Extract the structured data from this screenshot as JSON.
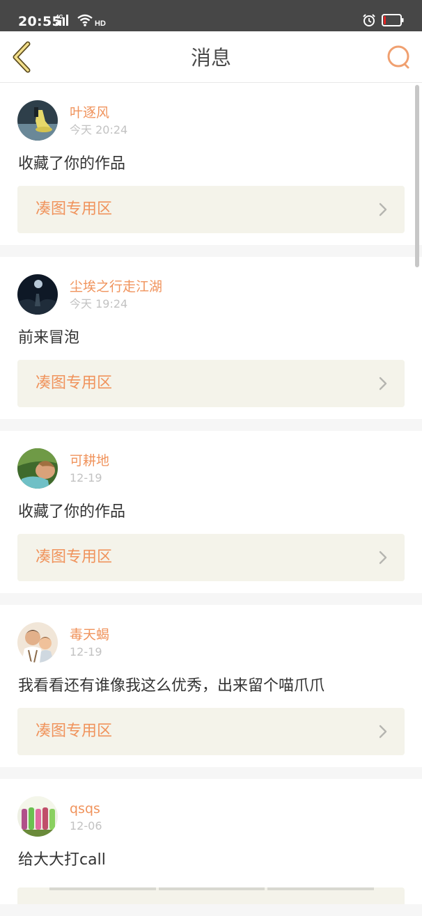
{
  "status_bar": {
    "time": "20:55",
    "network": "4G",
    "wifi_badge": "HD",
    "icons": [
      "signal-icon",
      "wifi-icon",
      "alarm-icon",
      "battery-icon"
    ],
    "battery_level": 0.15
  },
  "nav": {
    "title": "消息",
    "back_icon": "chevron-left-icon",
    "search_icon": "search-icon"
  },
  "colors": {
    "accent": "#f0935c",
    "status_bar": "#474747",
    "topic_bg": "#f4f3ea",
    "battery_low": "#e22323"
  },
  "messages": [
    {
      "user": "叶逐风",
      "time": "今天 20:24",
      "text": "收藏了你的作品",
      "topic": "凑图专用区"
    },
    {
      "user": "尘埃之行走江湖",
      "time": "今天 19:24",
      "text": "前来冒泡",
      "topic": "凑图专用区"
    },
    {
      "user": "可耕地",
      "time": "12-19",
      "text": "收藏了你的作品",
      "topic": "凑图专用区"
    },
    {
      "user": "毒天蝎",
      "time": "12-19",
      "text": "我看看还有谁像我这么优秀，出来留个喵爪爪",
      "topic": "凑图专用区"
    },
    {
      "user": "qsqs",
      "time": "12-06",
      "text": "给大大打call"
    }
  ]
}
